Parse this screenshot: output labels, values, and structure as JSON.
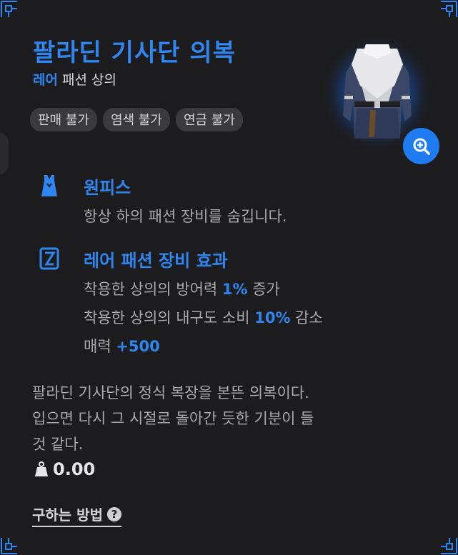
{
  "item": {
    "name": "팔라딘 기사단 의복",
    "rarity": "레어",
    "category": "패션 상의",
    "tags": [
      "판매 불가",
      "염색 불가",
      "연금 불가"
    ]
  },
  "effects": [
    {
      "icon": "dress-icon",
      "title": "원피스",
      "lines": [
        {
          "text": "항상 하의 패션 장비를 숨깁니다.",
          "value": "",
          "suffix": ""
        }
      ]
    },
    {
      "icon": "fashion-effect-icon",
      "title": "레어 패션 장비 효과",
      "lines": [
        {
          "text": "착용한 상의의 방어력 ",
          "value": "1%",
          "suffix": " 증가"
        },
        {
          "text": "착용한 상의의 내구도 소비 ",
          "value": "10%",
          "suffix": " 감소"
        },
        {
          "text": "매력 ",
          "value": "+500",
          "suffix": ""
        }
      ]
    }
  ],
  "description": [
    "팔라딘 기사단의 정식 복장을 본뜬 의복이다.",
    "입으면 다시 그 시절로 돌아간 듯한 기분이 들",
    "것 같다."
  ],
  "weight": "0.00",
  "how_to_obtain": "구하는 방법",
  "colors": {
    "accent": "#2f86f0",
    "background": "#1c1c1e"
  }
}
